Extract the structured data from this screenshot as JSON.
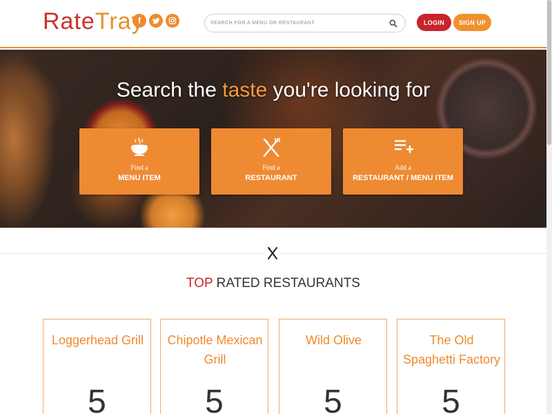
{
  "header": {
    "logo_part1": "Rate",
    "logo_part2": "Tray",
    "social": [
      {
        "icon": "facebook-icon",
        "glyph": "f"
      },
      {
        "icon": "twitter-icon",
        "glyph": "t"
      },
      {
        "icon": "instagram-icon",
        "glyph": "◎"
      }
    ],
    "search_placeholder": "SEARCH FOR A MENU OR RESTAURANT",
    "login_label": "LOGIN",
    "signup_label": "SIGN UP"
  },
  "hero": {
    "title_pre": "Search the ",
    "title_highlight": "taste",
    "title_post": " you're looking for",
    "cards": [
      {
        "icon": "food-bowl-icon",
        "small": "Find a",
        "big": "MENU ITEM"
      },
      {
        "icon": "fork-knife-icon",
        "small": "Find a",
        "big": "RESTAURANT"
      },
      {
        "icon": "add-list-icon",
        "small": "Add a",
        "big": "RESTAURANT / MENU ITEM"
      }
    ]
  },
  "top_rated": {
    "title_accent": "TOP",
    "title_rest": " RATED RESTAURANTS",
    "restaurants": [
      {
        "name": "Loggerhead Grill",
        "score": "5"
      },
      {
        "name": "Chipotle Mexican Grill",
        "score": "5"
      },
      {
        "name": "Wild Olive",
        "score": "5"
      },
      {
        "name": "The Old Spaghetti Factory",
        "score": "5"
      }
    ]
  },
  "colors": {
    "brand_orange": "#ef8a2f",
    "brand_red": "#c8242b"
  }
}
